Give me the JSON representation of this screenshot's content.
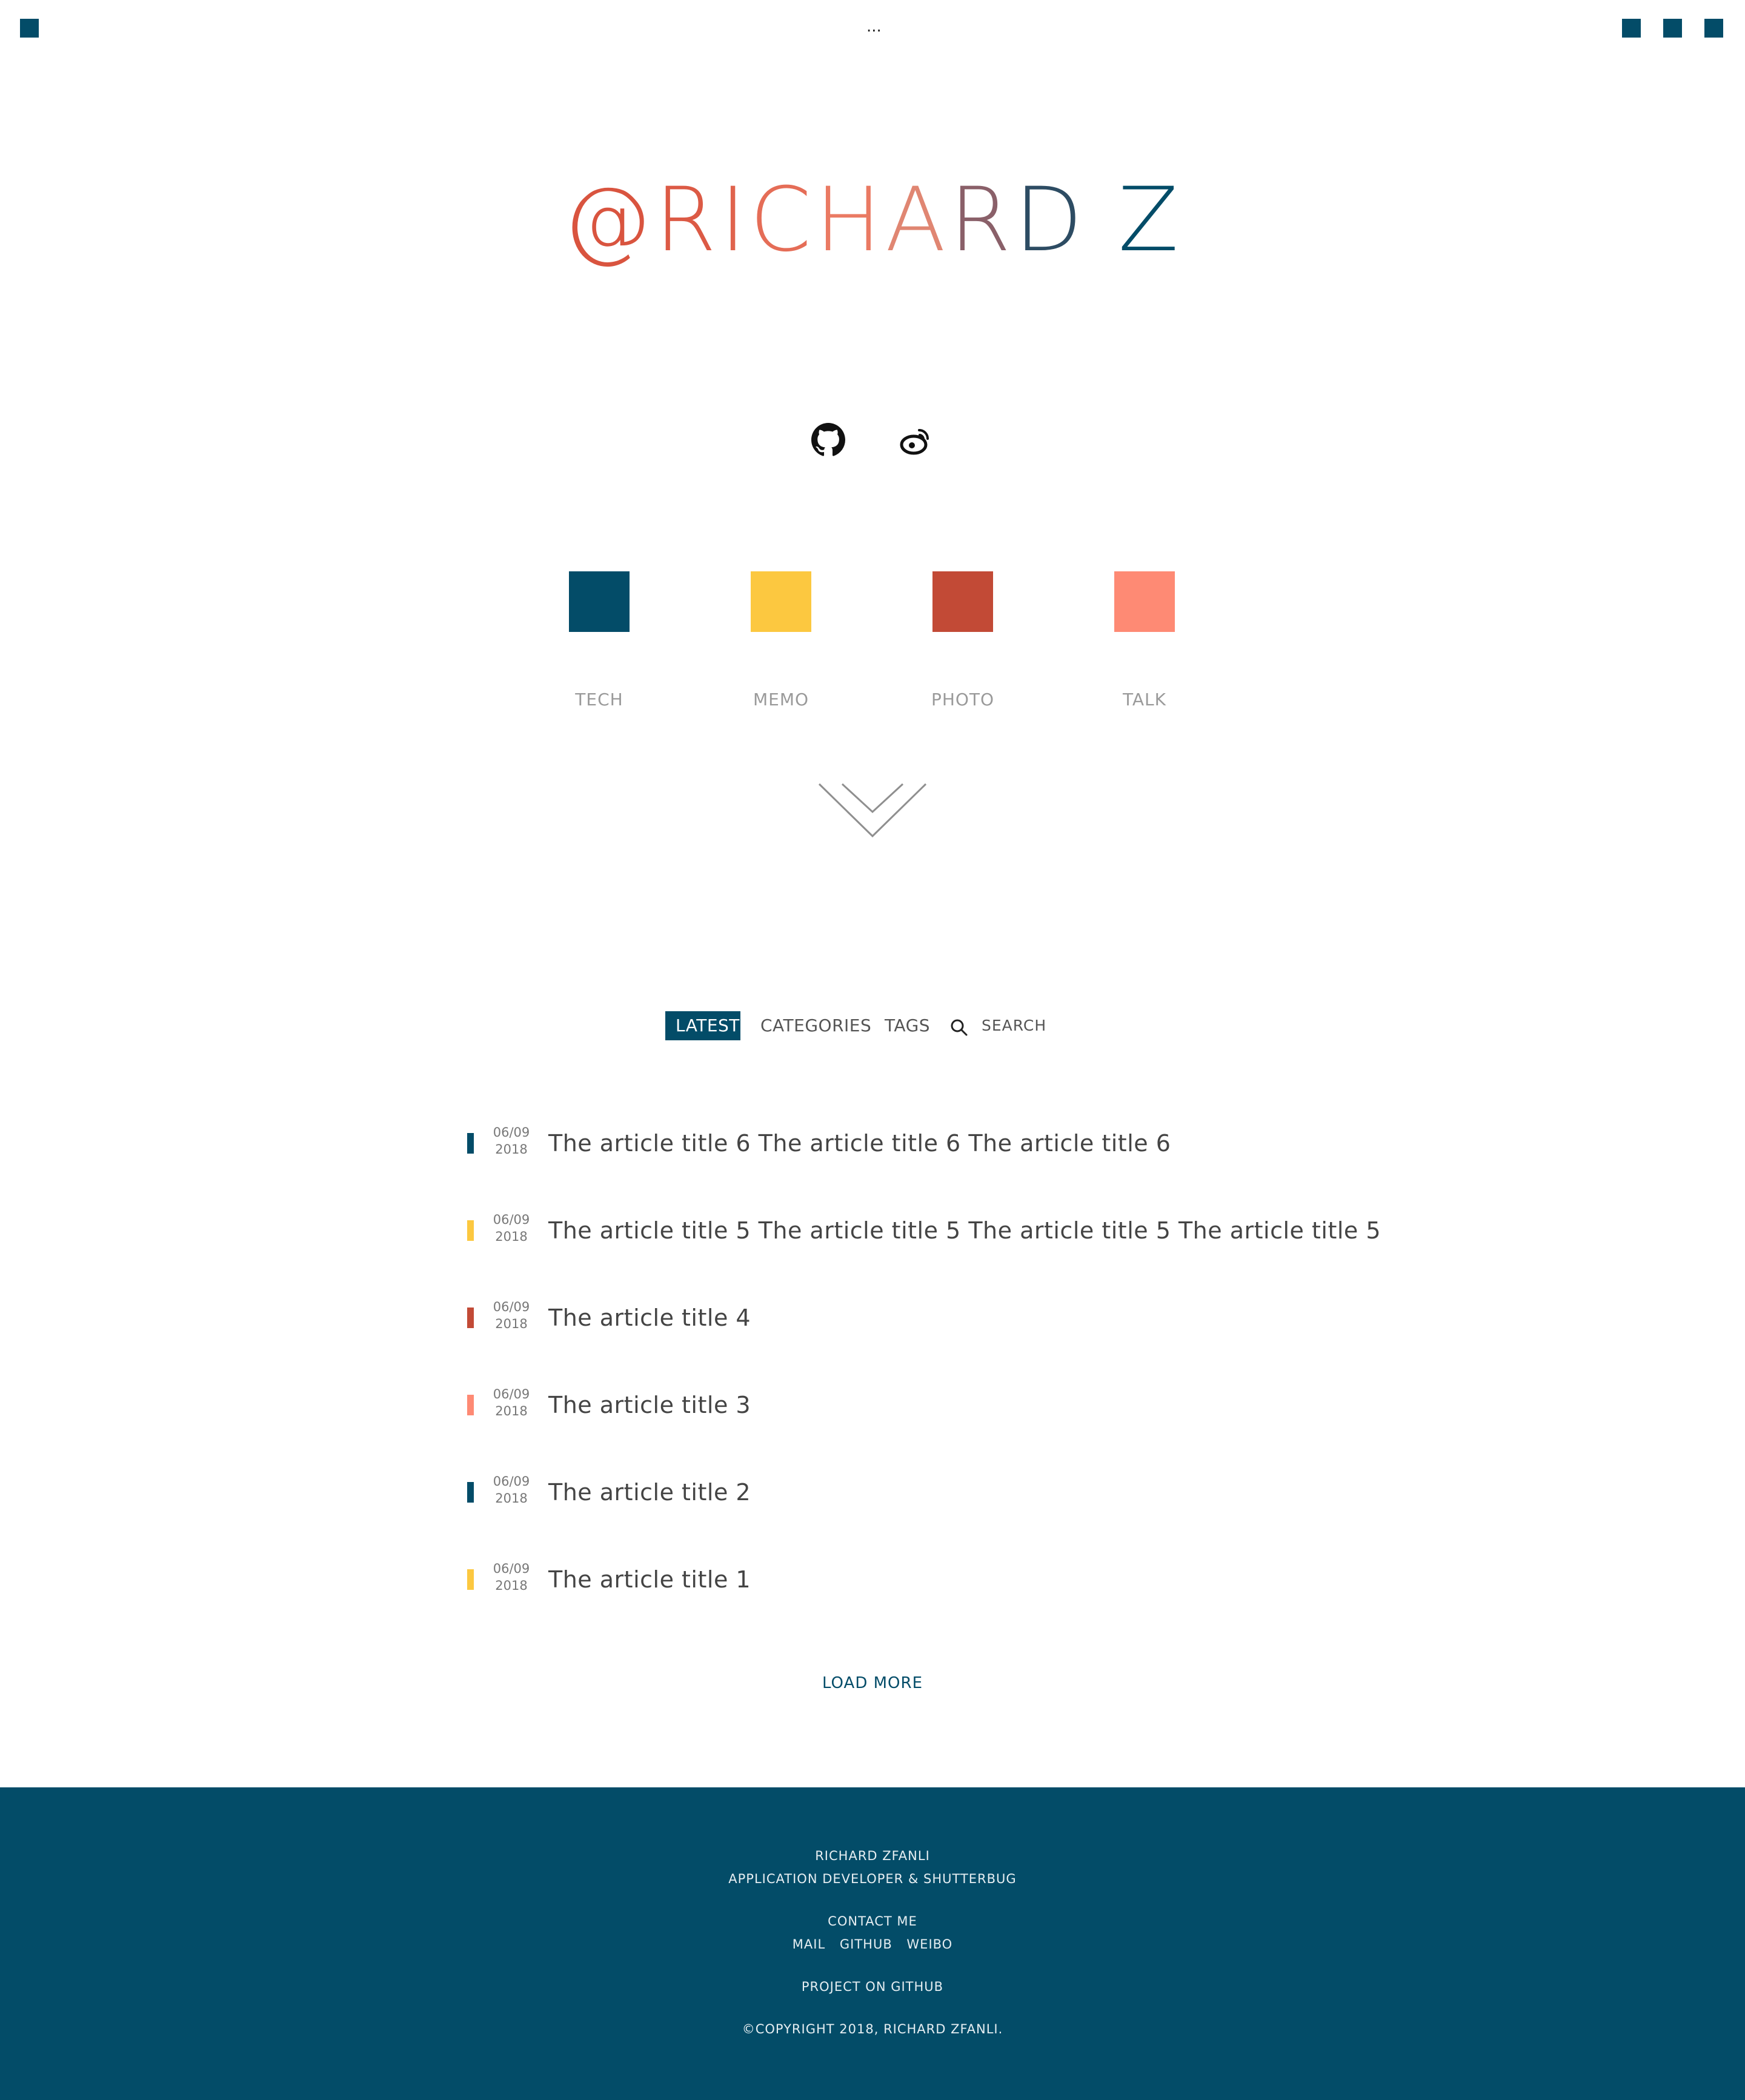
{
  "topbar": {
    "ellipsis": "...",
    "accent": "#034c68"
  },
  "logo": {
    "letters": [
      {
        "char": "@",
        "color": "#d9543f"
      },
      {
        "char": "R",
        "color": "#dc5a45"
      },
      {
        "char": "I",
        "color": "#e0634d"
      },
      {
        "char": "C",
        "color": "#e56d57"
      },
      {
        "char": "H",
        "color": "#ea7a63"
      },
      {
        "char": "A",
        "color": "#e08672"
      },
      {
        "char": "R",
        "color": "#8a6069"
      },
      {
        "char": "D",
        "color": "#2d4c63"
      },
      {
        "char": " ",
        "color": "#ffffff"
      },
      {
        "char": "Z",
        "color": "#034c68"
      }
    ]
  },
  "social": {
    "github_icon": "github-icon",
    "weibo_icon": "weibo-icon"
  },
  "categories": [
    {
      "label": "TECH",
      "color": "#034c68"
    },
    {
      "label": "MEMO",
      "color": "#fcc840"
    },
    {
      "label": "PHOTO",
      "color": "#c24a36"
    },
    {
      "label": "TALK",
      "color": "#fe8a74"
    }
  ],
  "tabs": {
    "latest": "LATEST",
    "categories": "CATEGORIES",
    "tags": "TAGS",
    "search": "SEARCH"
  },
  "articles": [
    {
      "date_md": "06/09",
      "year": "2018",
      "title": "The article title 6 The article title 6 The article title 6",
      "color": "#034c68"
    },
    {
      "date_md": "06/09",
      "year": "2018",
      "title": "The article title 5 The article title 5 The article title 5 The article title 5",
      "color": "#fcc840"
    },
    {
      "date_md": "06/09",
      "year": "2018",
      "title": "The article title 4",
      "color": "#c24a36"
    },
    {
      "date_md": "06/09",
      "year": "2018",
      "title": "The article title 3",
      "color": "#fe8a74"
    },
    {
      "date_md": "06/09",
      "year": "2018",
      "title": "The article title 2",
      "color": "#034c68"
    },
    {
      "date_md": "06/09",
      "year": "2018",
      "title": "The article title 1",
      "color": "#fcc840"
    }
  ],
  "load_more": "LOAD MORE",
  "footer": {
    "name": "RICHARD ZFANLI",
    "role": "APPLICATION DEVELOPER & SHUTTERBUG",
    "contact": "CONTACT ME",
    "links": [
      "MAIL",
      "GITHUB",
      "WEIBO"
    ],
    "project": "PROJECT ON GITHUB",
    "copyright": "©COPYRIGHT 2018, RICHARD ZFANLI."
  }
}
